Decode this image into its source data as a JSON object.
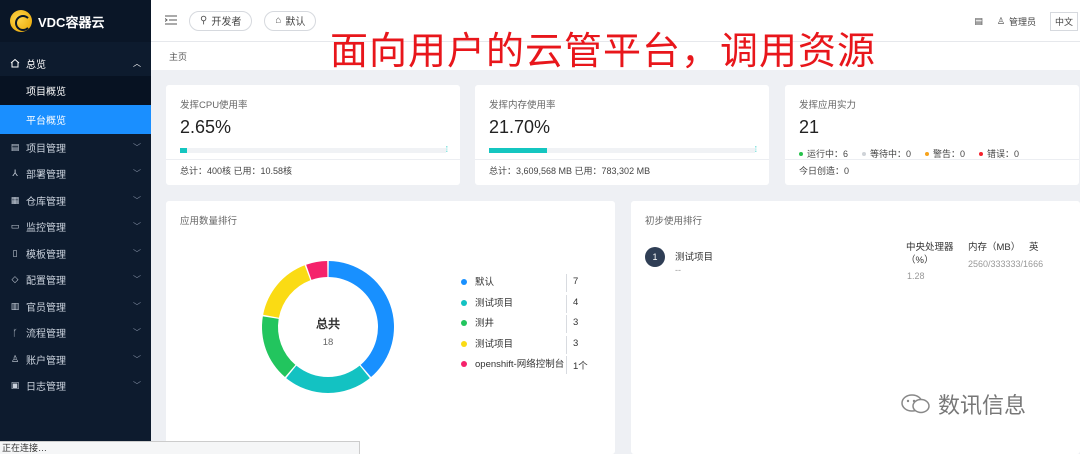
{
  "app": {
    "logo_text": "VDC容器云"
  },
  "overlay_caption": "面向用户的云管平台，调用资源",
  "topbar": {
    "menu_icon": "menu-fold-icon",
    "pill_developer": "开发者",
    "pill_default": "默认",
    "user_label": "管理员",
    "lang_label": "中文"
  },
  "breadcrumb": "主页",
  "sidebar": {
    "group": {
      "label": "总览",
      "icon": "home-icon"
    },
    "sub_items": [
      {
        "label": "项目概览"
      },
      {
        "label": "平台概览",
        "active": true
      }
    ],
    "items": [
      {
        "label": "项目管理",
        "icon": "project-icon"
      },
      {
        "label": "部署管理",
        "icon": "deploy-icon"
      },
      {
        "label": "仓库管理",
        "icon": "grid-icon"
      },
      {
        "label": "监控管理",
        "icon": "monitor-icon"
      },
      {
        "label": "模板管理",
        "icon": "template-icon"
      },
      {
        "label": "配置管理",
        "icon": "tag-icon"
      },
      {
        "label": "官员管理",
        "icon": "doc-icon"
      },
      {
        "label": "流程管理",
        "icon": "branch-icon"
      },
      {
        "label": "账户管理",
        "icon": "user-icon"
      },
      {
        "label": "日志管理",
        "icon": "log-icon"
      }
    ]
  },
  "cards": {
    "cpu": {
      "label": "发挥CPU使用率",
      "value": "2.65%",
      "progress": 0.0265,
      "foot": "总计：400核    已用：10.58核"
    },
    "mem": {
      "label": "发挥内存使用率",
      "value": "21.70%",
      "progress": 0.217,
      "foot": "总计：3,609,568 MB    已用：783,302 MB"
    },
    "apps": {
      "label": "发挥应用实力",
      "value": "21",
      "statuses": [
        {
          "label": "运行中：6",
          "color": "#27c24c"
        },
        {
          "label": "等待中：0",
          "color": "#cfd3d8"
        },
        {
          "label": "警告：0",
          "color": "#f7a31c"
        },
        {
          "label": "错误：0",
          "color": "#f5222d"
        }
      ],
      "foot": "今日创造：0"
    }
  },
  "rank_panel": {
    "title": "应用数量排行",
    "center_label": "总共",
    "center_value": "18"
  },
  "chart_data": {
    "type": "pie",
    "categories": [
      "默认",
      "测试项目",
      "测井",
      "测试项目",
      "openshift-网络控制台"
    ],
    "values": [
      7,
      4,
      3,
      3,
      1
    ],
    "value_labels": [
      "7",
      "4",
      "3",
      "3",
      "1个"
    ],
    "colors": [
      "#1890ff",
      "#13c2c2",
      "#22c55e",
      "#fadb14",
      "#f5226b"
    ],
    "title": "应用数量排行",
    "legend": "right"
  },
  "usage_panel": {
    "title": "初步使用排行",
    "badge": "1",
    "item_name": "测试项目",
    "item_sub": "--",
    "col_cpu": "中央处理器（%）",
    "col_mem": "内存（MB）",
    "col_extra": "英",
    "cpu_value": "1.28",
    "mem_value": "2560/333333/1666"
  },
  "status_bar": "正在连接…",
  "watermark": "数讯信息"
}
